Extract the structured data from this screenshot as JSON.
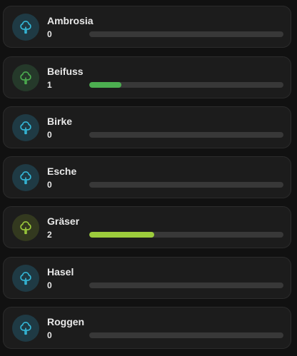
{
  "pollen_list": {
    "max_level": 6,
    "items": [
      {
        "label": "Ambrosia",
        "value": "0",
        "level": 0,
        "icon": "tree-icon",
        "icon_color": "#35b9d9",
        "badge_color": "#1f3a44",
        "bar_color": "#35b9d9"
      },
      {
        "label": "Beifuss",
        "value": "1",
        "level": 1,
        "icon": "tree-icon",
        "icon_color": "#4caf50",
        "badge_color": "#25392a",
        "bar_color": "#4caf50"
      },
      {
        "label": "Birke",
        "value": "0",
        "level": 0,
        "icon": "tree-icon",
        "icon_color": "#35b9d9",
        "badge_color": "#1f3a44",
        "bar_color": "#35b9d9"
      },
      {
        "label": "Esche",
        "value": "0",
        "level": 0,
        "icon": "tree-icon",
        "icon_color": "#35b9d9",
        "badge_color": "#1f3a44",
        "bar_color": "#35b9d9"
      },
      {
        "label": "Gräser",
        "value": "2",
        "level": 2,
        "icon": "tree-icon",
        "icon_color": "#9ccc3c",
        "badge_color": "#33391f",
        "bar_color": "#9ccc3c"
      },
      {
        "label": "Hasel",
        "value": "0",
        "level": 0,
        "icon": "tree-icon",
        "icon_color": "#35b9d9",
        "badge_color": "#1f3a44",
        "bar_color": "#35b9d9"
      },
      {
        "label": "Roggen",
        "value": "0",
        "level": 0,
        "icon": "tree-icon",
        "icon_color": "#35b9d9",
        "badge_color": "#1f3a44",
        "bar_color": "#35b9d9"
      }
    ]
  }
}
